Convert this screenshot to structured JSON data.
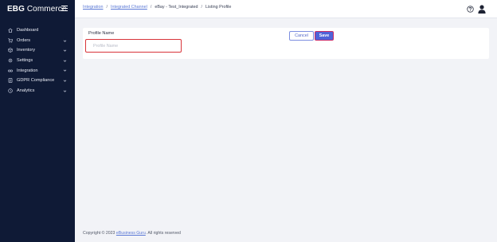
{
  "brand": {
    "bold": "EBG",
    "rest": " Commerce"
  },
  "sidebar": {
    "items": [
      {
        "label": "Dashboard",
        "icon": "home-icon",
        "has_chevron": false
      },
      {
        "label": "Orders",
        "icon": "cart-icon",
        "has_chevron": true
      },
      {
        "label": "Inventory",
        "icon": "box-icon",
        "has_chevron": true
      },
      {
        "label": "Settings",
        "icon": "gear-icon",
        "has_chevron": true
      },
      {
        "label": "Integration",
        "icon": "link-icon",
        "has_chevron": true
      },
      {
        "label": "GDPR Compliance",
        "icon": "document-icon",
        "has_chevron": true
      },
      {
        "label": "Analytics",
        "icon": "clock-icon",
        "has_chevron": true
      }
    ]
  },
  "breadcrumb": {
    "items": [
      {
        "label": "Integration",
        "link": true
      },
      {
        "label": "Integrated Channel",
        "link": true
      },
      {
        "label": "eBay - Test_Integrated",
        "link": false
      },
      {
        "label": "Listing Profile",
        "link": false
      }
    ],
    "separator": "/"
  },
  "form": {
    "profile_name_label": "Profile Name",
    "profile_name_value": "",
    "profile_name_placeholder": "Profile Name",
    "cancel_label": "Cancel",
    "save_label": "Save"
  },
  "footer": {
    "prefix": "Copyright © 2023 ",
    "link": "eBusiness Guru",
    "suffix": ". All rights reserved"
  },
  "colors": {
    "sidebar_bg": "#0f1a36",
    "accent": "#4f63d8",
    "error_border": "#d8343a",
    "link": "#5b79d6"
  }
}
